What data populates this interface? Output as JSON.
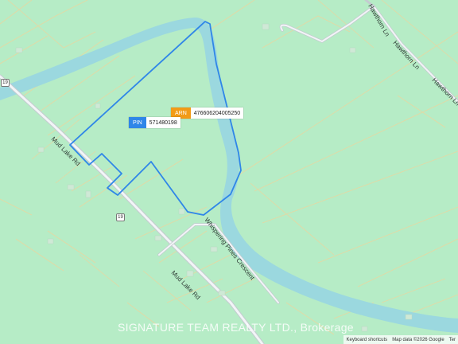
{
  "map": {
    "background_color": "#b6ecc6",
    "water_color": "#9bd8df",
    "parcel_outline_color": "#2f86e8",
    "road_color": "#c4cbd0",
    "roads": {
      "mud_lake_rd_upper": "Mud Lake Rd",
      "mud_lake_rd_lower": "Mud Lake Rd",
      "whispering_pines": "Whispering Pines Crescent",
      "hawthorn_1": "Hawthorn Ln",
      "hawthorn_2": "Hawthorn Ln",
      "hawthorn_3": "Hawthorn Ln"
    },
    "route_shields": [
      "19",
      "19"
    ]
  },
  "tags": {
    "pin": {
      "key": "PIN",
      "value": "571480198",
      "color": "#2f86e8"
    },
    "arn": {
      "key": "ARN",
      "value": "476606204005250",
      "color": "#f29b17"
    }
  },
  "watermark": "SIGNATURE TEAM REALTY LTD., Brokerage",
  "attribution": {
    "shortcuts": "Keyboard shortcuts",
    "data": "Map data ©2026 Google",
    "terms": "Ter"
  }
}
